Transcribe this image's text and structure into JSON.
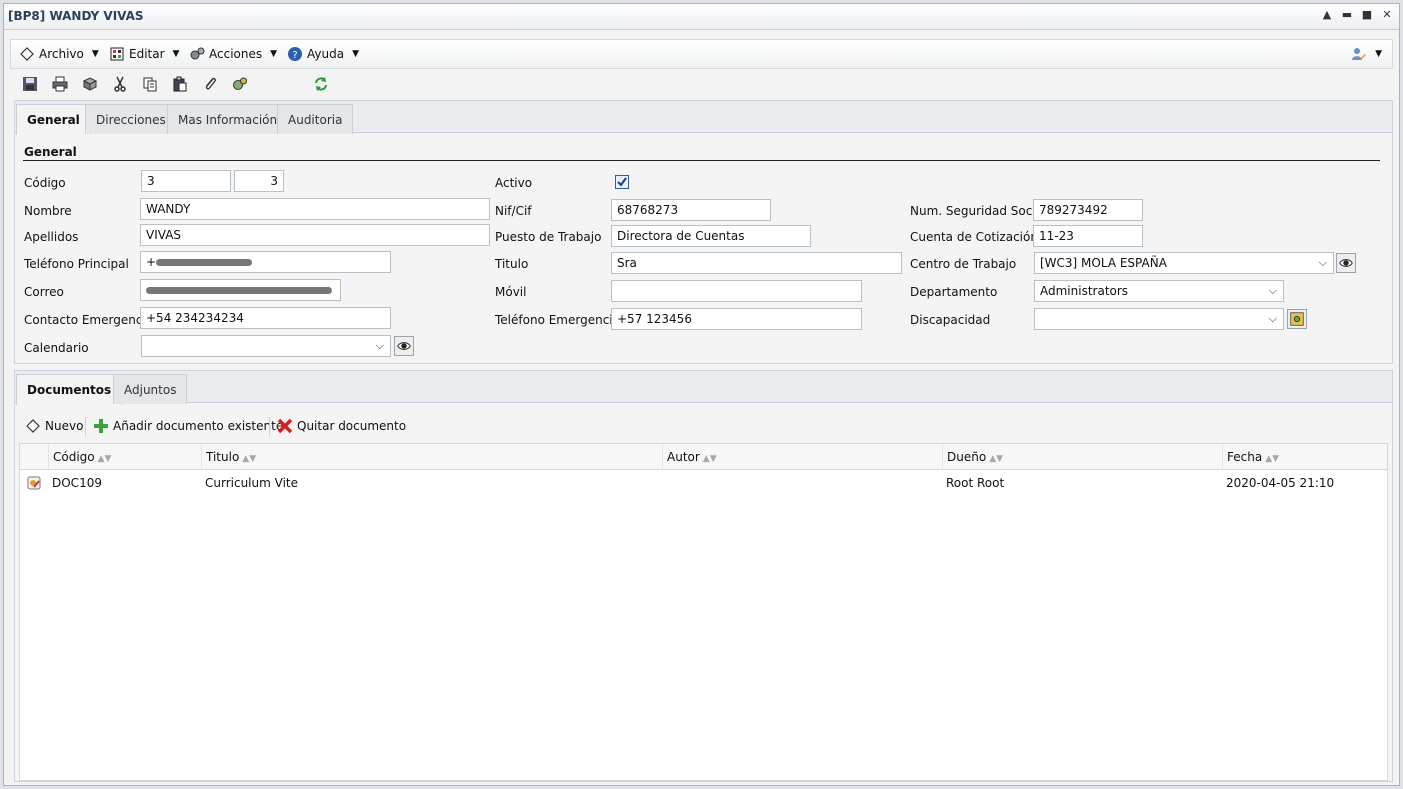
{
  "window": {
    "title": "[BP8] WANDY VIVAS"
  },
  "menu": {
    "archivo": "Archivo",
    "editar": "Editar",
    "acciones": "Acciones",
    "ayuda": "Ayuda"
  },
  "tabs": {
    "general": "General",
    "direcciones": "Direcciones",
    "mas_info": "Mas Información",
    "auditoria": "Auditoria"
  },
  "form": {
    "section_title": "General",
    "codigo_label": "Código",
    "codigo_value": "3",
    "codigo_value2": "3",
    "activo_label": "Activo",
    "activo_checked": true,
    "nombre_label": "Nombre",
    "nombre_value": "WANDY",
    "nif_label": "Nif/Cif",
    "nif_value": "68768273",
    "nss_label": "Num. Seguridad Social",
    "nss_value": "789273492",
    "apellidos_label": "Apellidos",
    "apellidos_value": "VIVAS",
    "puesto_label": "Puesto de Trabajo",
    "puesto_value": "Directora de Cuentas",
    "cotizacion_label": "Cuenta de Cotización",
    "cotizacion_value": "11-23",
    "telefono_label": "Teléfono Principal",
    "telefono_value": "+",
    "titulo_label": "Titulo",
    "titulo_value": "Sra",
    "centro_label": "Centro de Trabajo",
    "centro_value": "[WC3] MOLA ESPAÑA",
    "correo_label": "Correo",
    "movil_label": "Móvil",
    "movil_value": "",
    "departamento_label": "Departamento",
    "departamento_value": "Administrators",
    "contacto_label": "Contacto Emergencia",
    "contacto_value": "+54 234234234",
    "tel_emerg_label": "Teléfono Emergencia",
    "tel_emerg_value": "+57 123456",
    "discapacidad_label": "Discapacidad",
    "discapacidad_value": "",
    "calendario_label": "Calendario",
    "calendario_value": ""
  },
  "docs_tabs": {
    "documentos": "Documentos",
    "adjuntos": "Adjuntos"
  },
  "docs_toolbar": {
    "nuevo": "Nuevo",
    "anadir": "Añadir documento existente",
    "quitar": "Quitar documento"
  },
  "grid": {
    "columns": [
      "Código",
      "Titulo",
      "Autor",
      "Dueño",
      "Fecha"
    ],
    "rows": [
      {
        "codigo": "DOC109",
        "titulo": "Curriculum Vite",
        "autor": "",
        "dueno": "Root Root",
        "fecha": "2020-04-05 21:10"
      }
    ]
  },
  "colors": {
    "title_text": "#2b3f5c",
    "check_blue": "#2f5da8",
    "remove_red": "#d42020",
    "add_green": "#3aa33a"
  }
}
